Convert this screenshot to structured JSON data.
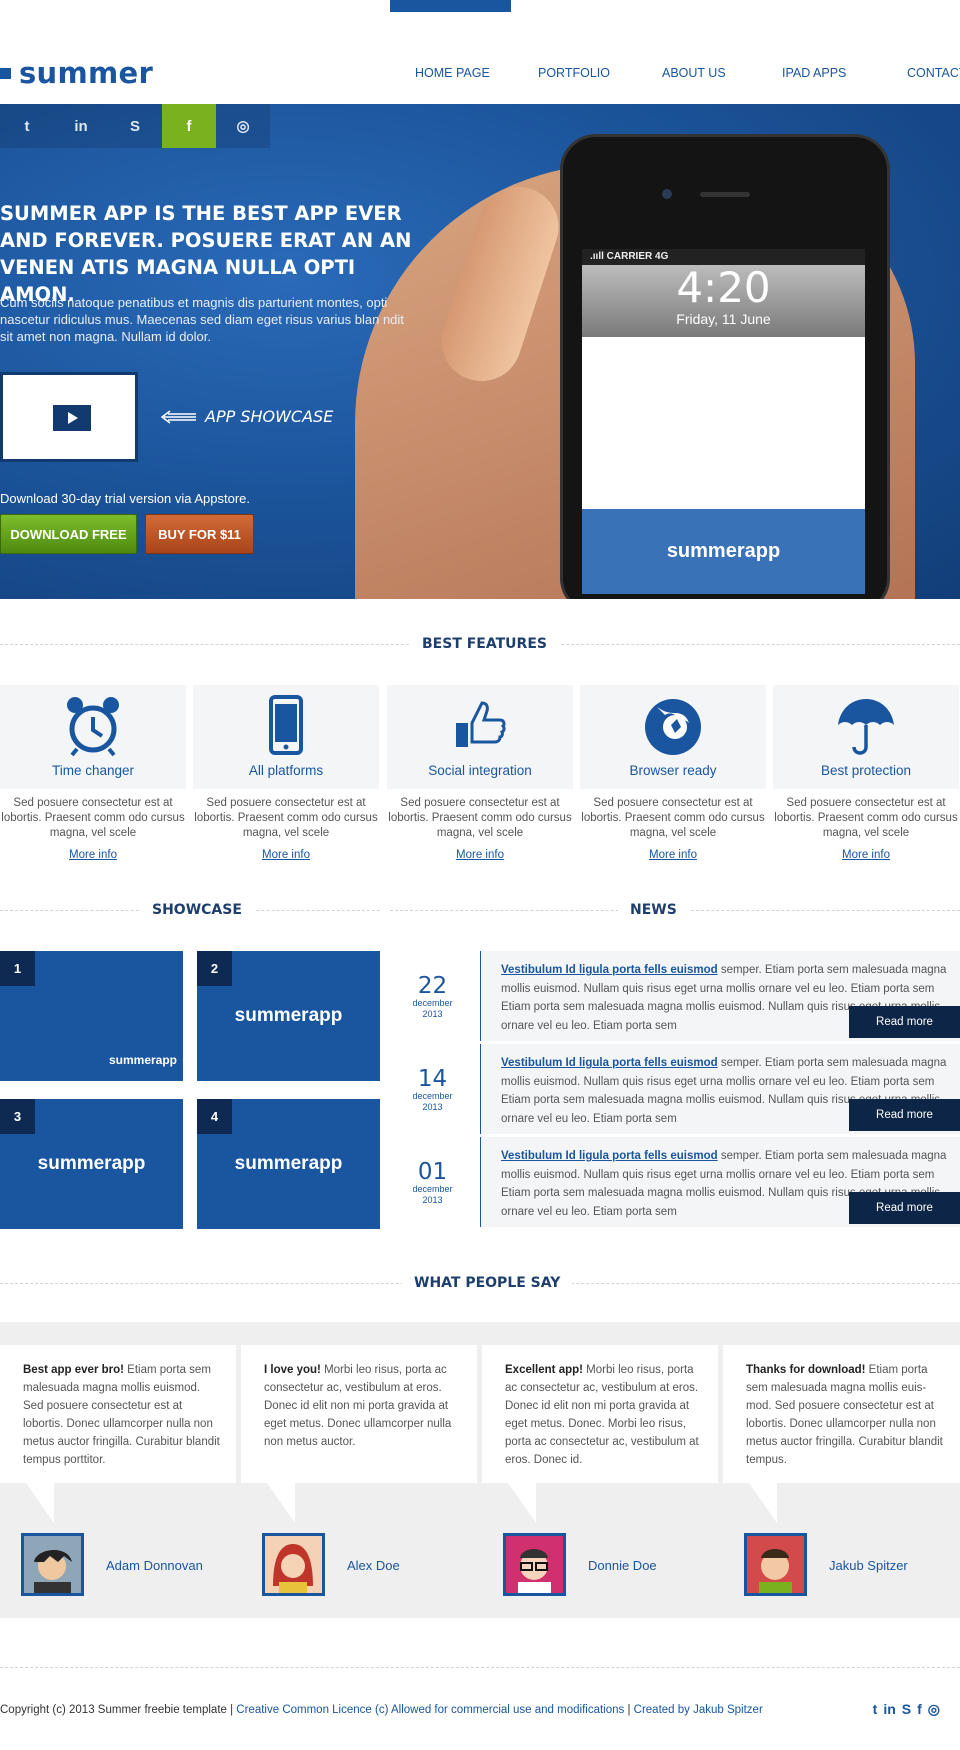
{
  "brand": {
    "name": "summer"
  },
  "nav": [
    "HOME PAGE",
    "PORTFOLIO",
    "ABOUT US",
    "IPAD APPS",
    "CONTACT"
  ],
  "social": [
    {
      "icon": "twitter-icon",
      "glyph": "t"
    },
    {
      "icon": "linkedin-icon",
      "glyph": "in"
    },
    {
      "icon": "skype-icon",
      "glyph": "S"
    },
    {
      "icon": "facebook-icon",
      "glyph": "f"
    },
    {
      "icon": "dribbble-icon",
      "glyph": "◎"
    }
  ],
  "hero": {
    "headline": "SUMMER APP IS THE BEST APP EVER AND FOREVER. POSUERE ERAT AN AN VENEN ATIS MAGNA NULLA OPTI AMON.",
    "description": "Cum sociis natoque penatibus et magnis dis parturient montes, opti nascetur ridiculus mus. Maecenas sed diam eget risus varius blan ndit sit amet non magna. Nullam id dolor.",
    "showcase_label": "APP SHOWCASE",
    "trial": "Download 30-day trial version via Appstore.",
    "download_btn": "DOWNLOAD FREE",
    "buy_btn": "BUY FOR $11",
    "phone": {
      "carrier": ".ııll CARRIER  4G",
      "time": "4:20",
      "date": "Friday, 11 June",
      "app": "summerapp"
    }
  },
  "features": {
    "title": "BEST FEATURES",
    "items": [
      {
        "name": "Time changer",
        "icon": "alarm-clock-icon",
        "desc": "Sed posuere consectetur est at lobortis. Praesent comm odo cursus magna, vel scele",
        "more": "More info"
      },
      {
        "name": "All platforms",
        "icon": "smartphone-icon",
        "desc": "Sed posuere consectetur est at lobortis. Praesent comm odo cursus magna, vel scele",
        "more": "More info"
      },
      {
        "name": "Social integration",
        "icon": "thumbs-up-icon",
        "desc": "Sed posuere consectetur est at lobortis. Praesent comm odo cursus magna, vel scele",
        "more": "More info"
      },
      {
        "name": "Browser ready",
        "icon": "firefox-icon",
        "desc": "Sed posuere consectetur est at lobortis. Praesent comm odo cursus magna, vel scele",
        "more": "More info"
      },
      {
        "name": "Best protection",
        "icon": "umbrella-icon",
        "desc": "Sed posuere consectetur est at lobortis. Praesent comm odo cursus magna, vel scele",
        "more": "More info"
      }
    ]
  },
  "showcase": {
    "title": "SHOWCASE",
    "tiles": [
      {
        "num": "1",
        "label": "summerapp"
      },
      {
        "num": "2",
        "label": "summerapp"
      },
      {
        "num": "3",
        "label": "summerapp"
      },
      {
        "num": "4",
        "label": "summerapp"
      }
    ]
  },
  "news": {
    "title": "NEWS",
    "items": [
      {
        "day": "22",
        "month": "december",
        "year": "2013",
        "headline": "Vestibulum Id ligula porta fells euismod",
        "text": " semper. Etiam porta sem malesuada magna mollis euismod. Nullam quis risus eget urna mollis ornare vel eu leo. Etiam porta sem Etiam porta sem malesuada magna mollis euismod. Nullam quis risus eget urna mollis ornare vel eu leo. Etiam porta sem",
        "read": "Read more"
      },
      {
        "day": "14",
        "month": "december",
        "year": "2013",
        "headline": "Vestibulum Id ligula porta fells euismod",
        "text": " semper. Etiam porta sem malesuada magna mollis euismod. Nullam quis risus eget urna mollis ornare vel eu leo. Etiam porta sem Etiam porta sem malesuada magna mollis euismod. Nullam quis risus eget urna mollis ornare vel eu leo. Etiam porta sem",
        "read": "Read more"
      },
      {
        "day": "01",
        "month": "december",
        "year": "2013",
        "headline": "Vestibulum Id ligula porta fells euismod",
        "text": " semper. Etiam porta sem malesuada magna mollis euismod. Nullam quis risus eget urna mollis ornare vel eu leo. Etiam porta sem Etiam porta sem malesuada magna mollis euismod. Nullam quis risus eget urna mollis ornare vel eu leo. Etiam porta sem",
        "read": "Read more"
      }
    ]
  },
  "testimonials": {
    "title": "WHAT PEOPLE SAY",
    "items": [
      {
        "bold": "Best app ever bro!",
        "text": " Etiam porta sem malesuada magna mollis euismod. Sed posuere consectetur est at lobortis. Donec ullamcorper nulla non metus auctor fringilla. Curabitur blandit tempus porttitor.",
        "name": "Adam Donnovan"
      },
      {
        "bold": "I love you!",
        "text": " Morbi leo risus, porta ac consectetur ac, vestibulum at eros. Donec id elit non mi porta gravida at eget metus. Donec ullamcorper nulla non metus auctor.",
        "name": "Alex Doe"
      },
      {
        "bold": "Excellent app!",
        "text": " Morbi leo risus, porta ac consectetur ac, vestibulum at eros. Donec id elit non mi porta gravida at eget metus. Donec. Morbi leo risus, porta ac consectetur ac, vestibulum at eros. Donec id.",
        "name": "Donnie Doe"
      },
      {
        "bold": "Thanks for download!",
        "text": " Etiam porta sem malesuada magna mollis euis-mod. Sed posuere consectetur est at lobortis. Donec ullamcorper nulla non metus auctor fringilla. Curabitur blandit tempus.",
        "name": "Jakub Spitzer"
      }
    ]
  },
  "footer": {
    "copyright": "Copyright (c) 2013 Summer freebie template",
    "sep1": "  |  ",
    "licence": "Creative Common Licence (c) Allowed for commercial use and modifications",
    "sep2": "  |  ",
    "created": "Created by Jakub Spitzer"
  },
  "colors": {
    "brand": "#1a56a0",
    "dark": "#0d2547",
    "green": "#6aaa1e",
    "orange": "#c0551f"
  }
}
